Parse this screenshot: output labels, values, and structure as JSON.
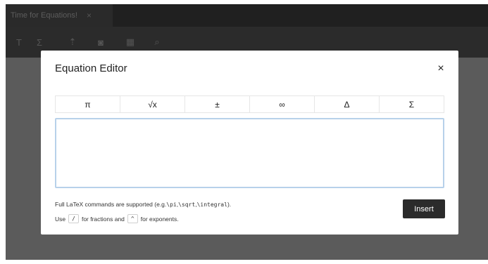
{
  "window": {
    "tab_title": "Time for Equations!",
    "tab_close": "×"
  },
  "toolbar": {
    "items": [
      {
        "icon": "text-icon",
        "glyph": "T"
      },
      {
        "icon": "sigma-icon",
        "glyph": "Σ"
      },
      {
        "icon": "upload-icon",
        "glyph": "⇡"
      },
      {
        "icon": "camera-icon",
        "glyph": "◙"
      },
      {
        "icon": "table-icon",
        "glyph": "▦"
      },
      {
        "icon": "search-icon",
        "glyph": "⌕"
      }
    ]
  },
  "modal": {
    "title": "Equation Editor",
    "close": "×",
    "symbols": [
      "π",
      "√x",
      "±",
      "∞",
      "Δ",
      "Σ"
    ],
    "editor_value": "",
    "help": {
      "line1_prefix": "Full LaTeX commands are supported (e.g. ",
      "cmd_pi": "\\pi",
      "sep1": ", ",
      "cmd_sqrt": "\\sqrt",
      "sep2": ", ",
      "cmd_integral": "\\integral",
      "line1_suffix": ").",
      "line2_use": "Use",
      "key_fraction": "/",
      "line2_mid": "for fractions and",
      "key_exponent": "^",
      "line2_end": "for exponents."
    },
    "insert_label": "Insert"
  }
}
